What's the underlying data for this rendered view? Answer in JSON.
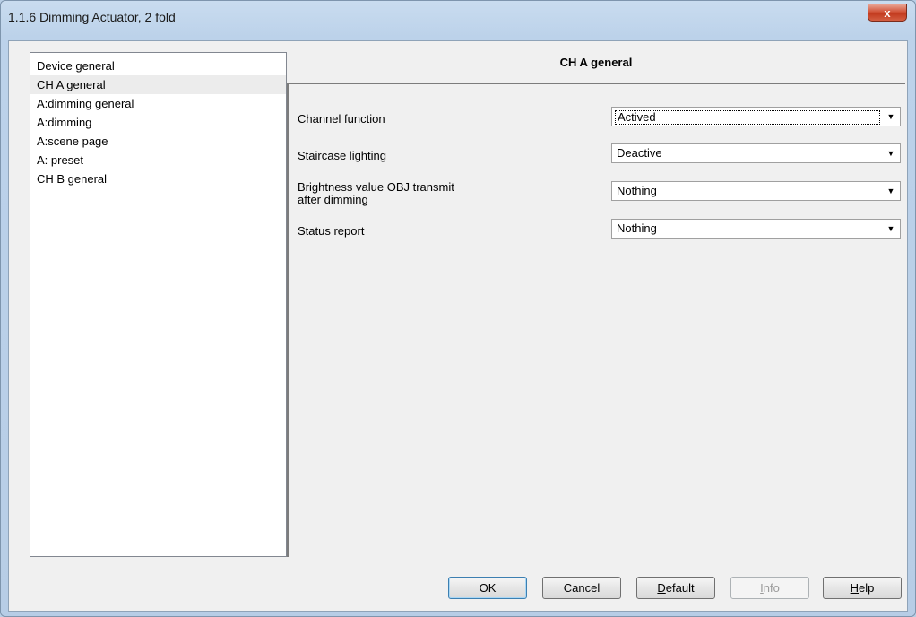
{
  "window": {
    "title": "1.1.6 Dimming Actuator, 2 fold",
    "close_label": "x"
  },
  "nav": {
    "items": [
      {
        "label": "Device general"
      },
      {
        "label": "CH A general",
        "selected": true
      },
      {
        "label": "A:dimming general"
      },
      {
        "label": "A:dimming"
      },
      {
        "label": "A:scene page"
      },
      {
        "label": "A: preset"
      },
      {
        "label": "CH B general"
      }
    ]
  },
  "panel": {
    "title": "CH A general",
    "params": [
      {
        "label": "Channel function",
        "value": "Actived"
      },
      {
        "label": "Staircase lighting",
        "value": "Deactive"
      },
      {
        "label_line1": "Brightness value OBJ transmit",
        "label_line2": "after dimming",
        "value": "Nothing"
      },
      {
        "label": "Status report",
        "value": "Nothing"
      }
    ]
  },
  "buttons": {
    "ok": "OK",
    "cancel": "Cancel",
    "default_first": "D",
    "default_rest": "efault",
    "info_first": "I",
    "info_rest": "nfo",
    "help_first": "H",
    "help_rest": "elp"
  },
  "icons": {
    "dropdown": "chevron-down-icon",
    "close": "close-icon"
  },
  "colors": {
    "frame": "#b9cfe6",
    "close_button": "#c23a1e",
    "client_background": "#f0f0f0",
    "default_button_border": "#3c7fb1"
  }
}
